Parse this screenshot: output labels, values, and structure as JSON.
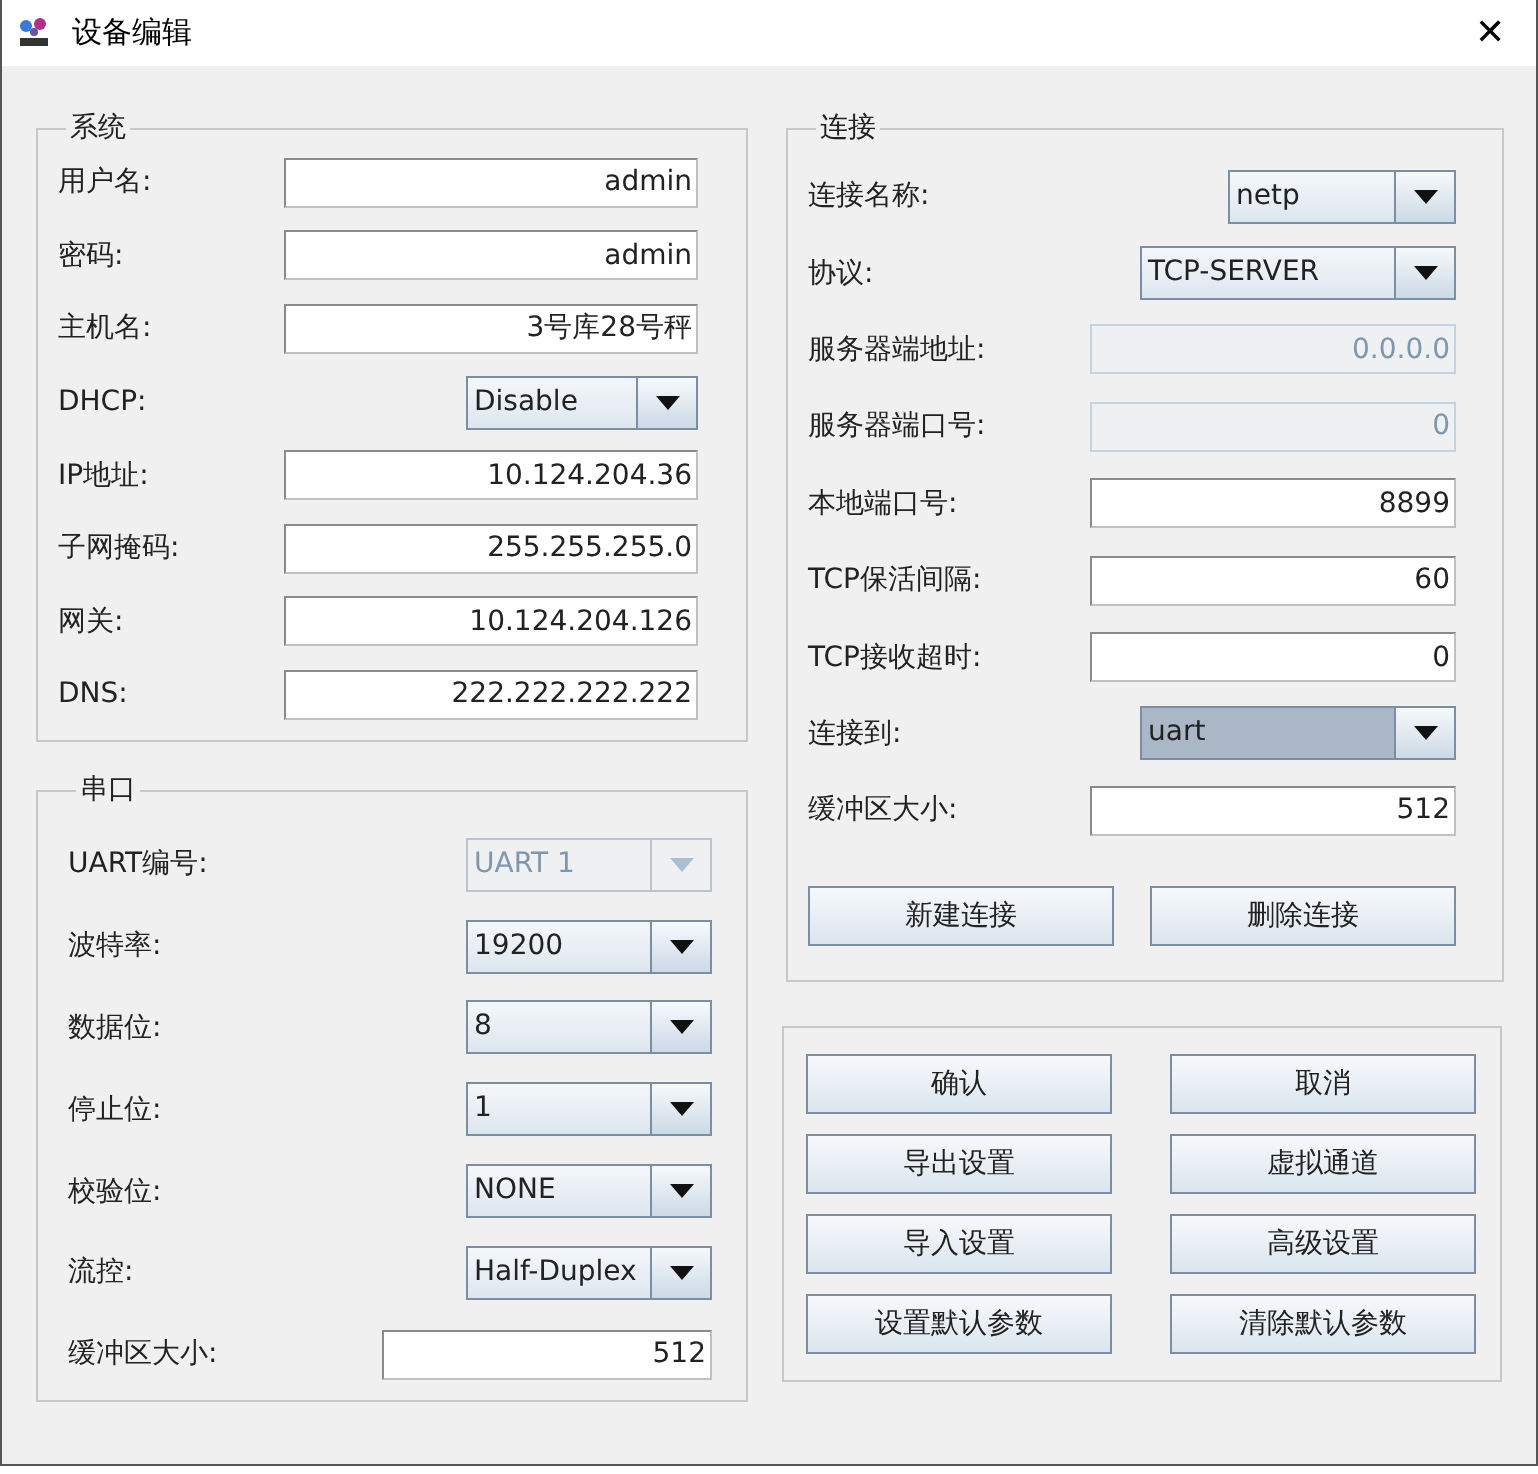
{
  "window": {
    "title": "设备编辑",
    "close": "✕"
  },
  "system": {
    "title": "系统",
    "rows": [
      {
        "kind": "field",
        "label": "用户名:",
        "value": "admin",
        "disabled": false,
        "focused": false
      },
      {
        "kind": "field",
        "label": "密码:",
        "value": "admin",
        "disabled": false,
        "focused": false
      },
      {
        "kind": "field",
        "label": "主机名:",
        "value": "3号库28号秤",
        "disabled": false,
        "focused": false
      },
      {
        "kind": "select",
        "label": "DHCP:",
        "value": "Disable",
        "disabled": false,
        "focused": false
      },
      {
        "kind": "field",
        "label": "IP地址:",
        "value": "10.124.204.36",
        "disabled": false,
        "focused": false
      },
      {
        "kind": "field",
        "label": "子网掩码:",
        "value": "255.255.255.0",
        "disabled": false,
        "focused": false
      },
      {
        "kind": "field",
        "label": "网关:",
        "value": "10.124.204.126",
        "disabled": false,
        "focused": false
      },
      {
        "kind": "field",
        "label": "DNS:",
        "value": "222.222.222.222",
        "disabled": false,
        "focused": false
      }
    ]
  },
  "serial": {
    "title": "串口",
    "rows": [
      {
        "kind": "select",
        "label": "UART编号:",
        "value": "UART 1",
        "disabled": true,
        "focused": false
      },
      {
        "kind": "select",
        "label": "波特率:",
        "value": "19200",
        "disabled": false,
        "focused": false
      },
      {
        "kind": "select",
        "label": "数据位:",
        "value": "8",
        "disabled": false,
        "focused": false
      },
      {
        "kind": "select",
        "label": "停止位:",
        "value": "1",
        "disabled": false,
        "focused": false
      },
      {
        "kind": "select",
        "label": "校验位:",
        "value": "NONE",
        "disabled": false,
        "focused": false
      },
      {
        "kind": "select",
        "label": "流控:",
        "value": "Half-Duplex",
        "disabled": false,
        "focused": false
      },
      {
        "kind": "field",
        "label": "缓冲区大小:",
        "value": "512",
        "disabled": false,
        "focused": false
      }
    ]
  },
  "connection": {
    "title": "连接",
    "rows": [
      {
        "kind": "select",
        "label": "连接名称:",
        "value": "netp",
        "disabled": false,
        "focused": false
      },
      {
        "kind": "select",
        "label": "协议:",
        "value": "TCP-SERVER",
        "disabled": false,
        "focused": false
      },
      {
        "kind": "field",
        "label": "服务器端地址:",
        "value": "0.0.0.0",
        "disabled": true,
        "focused": false
      },
      {
        "kind": "field",
        "label": "服务器端口号:",
        "value": "0",
        "disabled": true,
        "focused": false
      },
      {
        "kind": "field",
        "label": "本地端口号:",
        "value": "8899",
        "disabled": false,
        "focused": false
      },
      {
        "kind": "field",
        "label": "TCP保活间隔:",
        "value": "60",
        "disabled": false,
        "focused": false
      },
      {
        "kind": "field",
        "label": "TCP接收超时:",
        "value": "0",
        "disabled": false,
        "focused": false
      },
      {
        "kind": "select",
        "label": "连接到:",
        "value": "uart",
        "disabled": false,
        "focused": true
      },
      {
        "kind": "field",
        "label": "缓冲区大小:",
        "value": "512",
        "disabled": false,
        "focused": false
      }
    ],
    "buttons": [
      "新建连接",
      "删除连接"
    ]
  },
  "actions": [
    "确认",
    "取消",
    "导出设置",
    "虚拟通道",
    "导入设置",
    "高级设置",
    "设置默认参数",
    "清除默认参数"
  ]
}
